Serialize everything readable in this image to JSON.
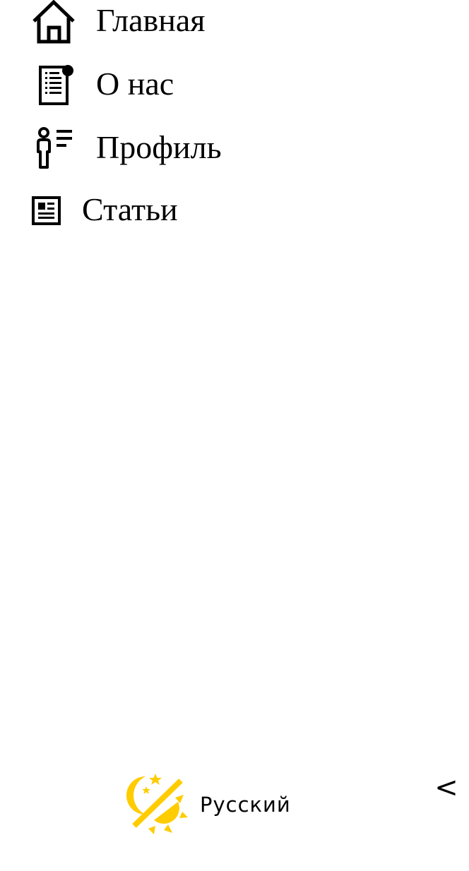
{
  "sidebar": {
    "items": [
      {
        "label": "Главная",
        "icon": "home-icon"
      },
      {
        "label": "О нас",
        "icon": "document-notification-icon"
      },
      {
        "label": "Профиль",
        "icon": "profile-list-icon"
      },
      {
        "label": "Статьи",
        "icon": "article-icon"
      }
    ]
  },
  "footer": {
    "theme_icon": "theme-switcher-icon",
    "theme_color": "#ffcc00",
    "language_label": "Русский",
    "collapse_label": "<"
  }
}
